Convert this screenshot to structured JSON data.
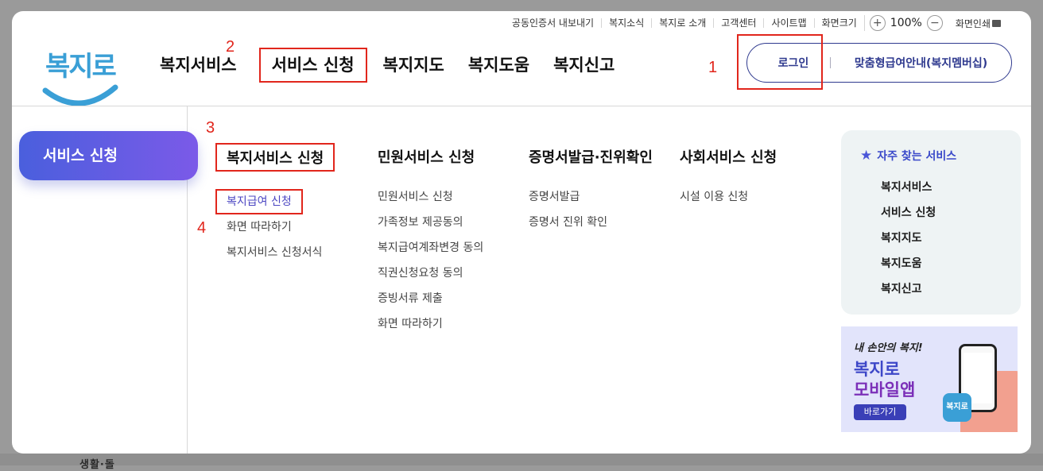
{
  "utility": {
    "items": [
      "공동인증서 내보내기",
      "복지소식",
      "복지로 소개",
      "고객센터",
      "사이트맵",
      "화면크기"
    ],
    "zoom_plus": "+",
    "zoom_value": "100%",
    "zoom_minus": "−",
    "print_label": "화면인쇄"
  },
  "logo": {
    "text": "복지로"
  },
  "gnb": {
    "items": [
      "복지서비스",
      "서비스 신청",
      "복지지도",
      "복지도움",
      "복지신고"
    ]
  },
  "header": {
    "login_label": "로그인",
    "member_label": "맞춤형급여안내(복지멤버십)"
  },
  "annotations": {
    "a1": "1",
    "a2": "2",
    "a3": "3",
    "a4": "4"
  },
  "side": {
    "label": "서비스 신청"
  },
  "menu": {
    "columns": [
      {
        "title": "복지서비스 신청",
        "items": [
          "복지급여 신청",
          "화면 따라하기",
          "복지서비스 신청서식"
        ]
      },
      {
        "title": "민원서비스 신청",
        "items": [
          "민원서비스 신청",
          "가족정보 제공동의",
          "복지급여계좌변경 동의",
          "직권신청요청 동의",
          "증빙서류 제출",
          "화면 따라하기"
        ]
      },
      {
        "title": "증명서발급·진위확인",
        "items": [
          "증명서발급",
          "증명서 진위 확인"
        ]
      },
      {
        "title": "사회서비스 신청",
        "items": [
          "시설 이용 신청"
        ]
      }
    ]
  },
  "favorites": {
    "title": "자주 찾는 서비스",
    "items": [
      "복지서비스",
      "서비스 신청",
      "복지지도",
      "복지도움",
      "복지신고"
    ]
  },
  "banner": {
    "subtitle": "내 손안의 복지!",
    "title_line1": "복지로",
    "title_line2": "모바일앱",
    "go_label": "바로가기",
    "app_icon_text": "복지로"
  },
  "colors": {
    "accent": "#2f3a8f",
    "highlight": "#e1261c",
    "active_link": "#4b46c2"
  }
}
